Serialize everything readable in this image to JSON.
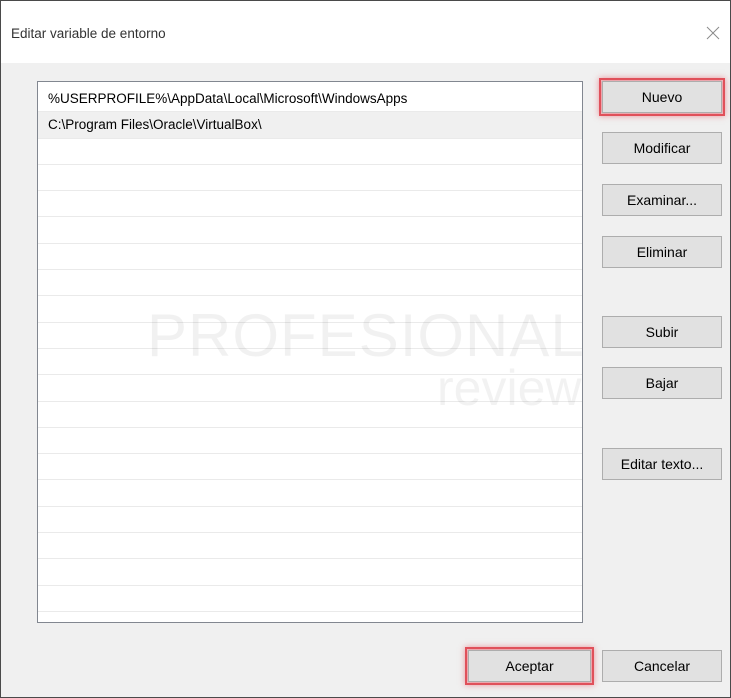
{
  "window": {
    "title": "Editar variable de entorno"
  },
  "list": {
    "items": [
      "%USERPROFILE%\\AppData\\Local\\Microsoft\\WindowsApps",
      "C:\\Program Files\\Oracle\\VirtualBox\\"
    ],
    "selected_index": 1
  },
  "buttons": {
    "new": "Nuevo",
    "edit": "Modificar",
    "browse": "Examinar...",
    "delete": "Eliminar",
    "move_up": "Subir",
    "move_down": "Bajar",
    "edit_text": "Editar texto...",
    "ok": "Aceptar",
    "cancel": "Cancelar"
  },
  "watermark": {
    "line1": "PROFESIONAL",
    "line2": "review"
  },
  "colors": {
    "highlight": "#e0505a",
    "selected_row": "#f0f0f0",
    "button_face": "#e1e1e1"
  }
}
